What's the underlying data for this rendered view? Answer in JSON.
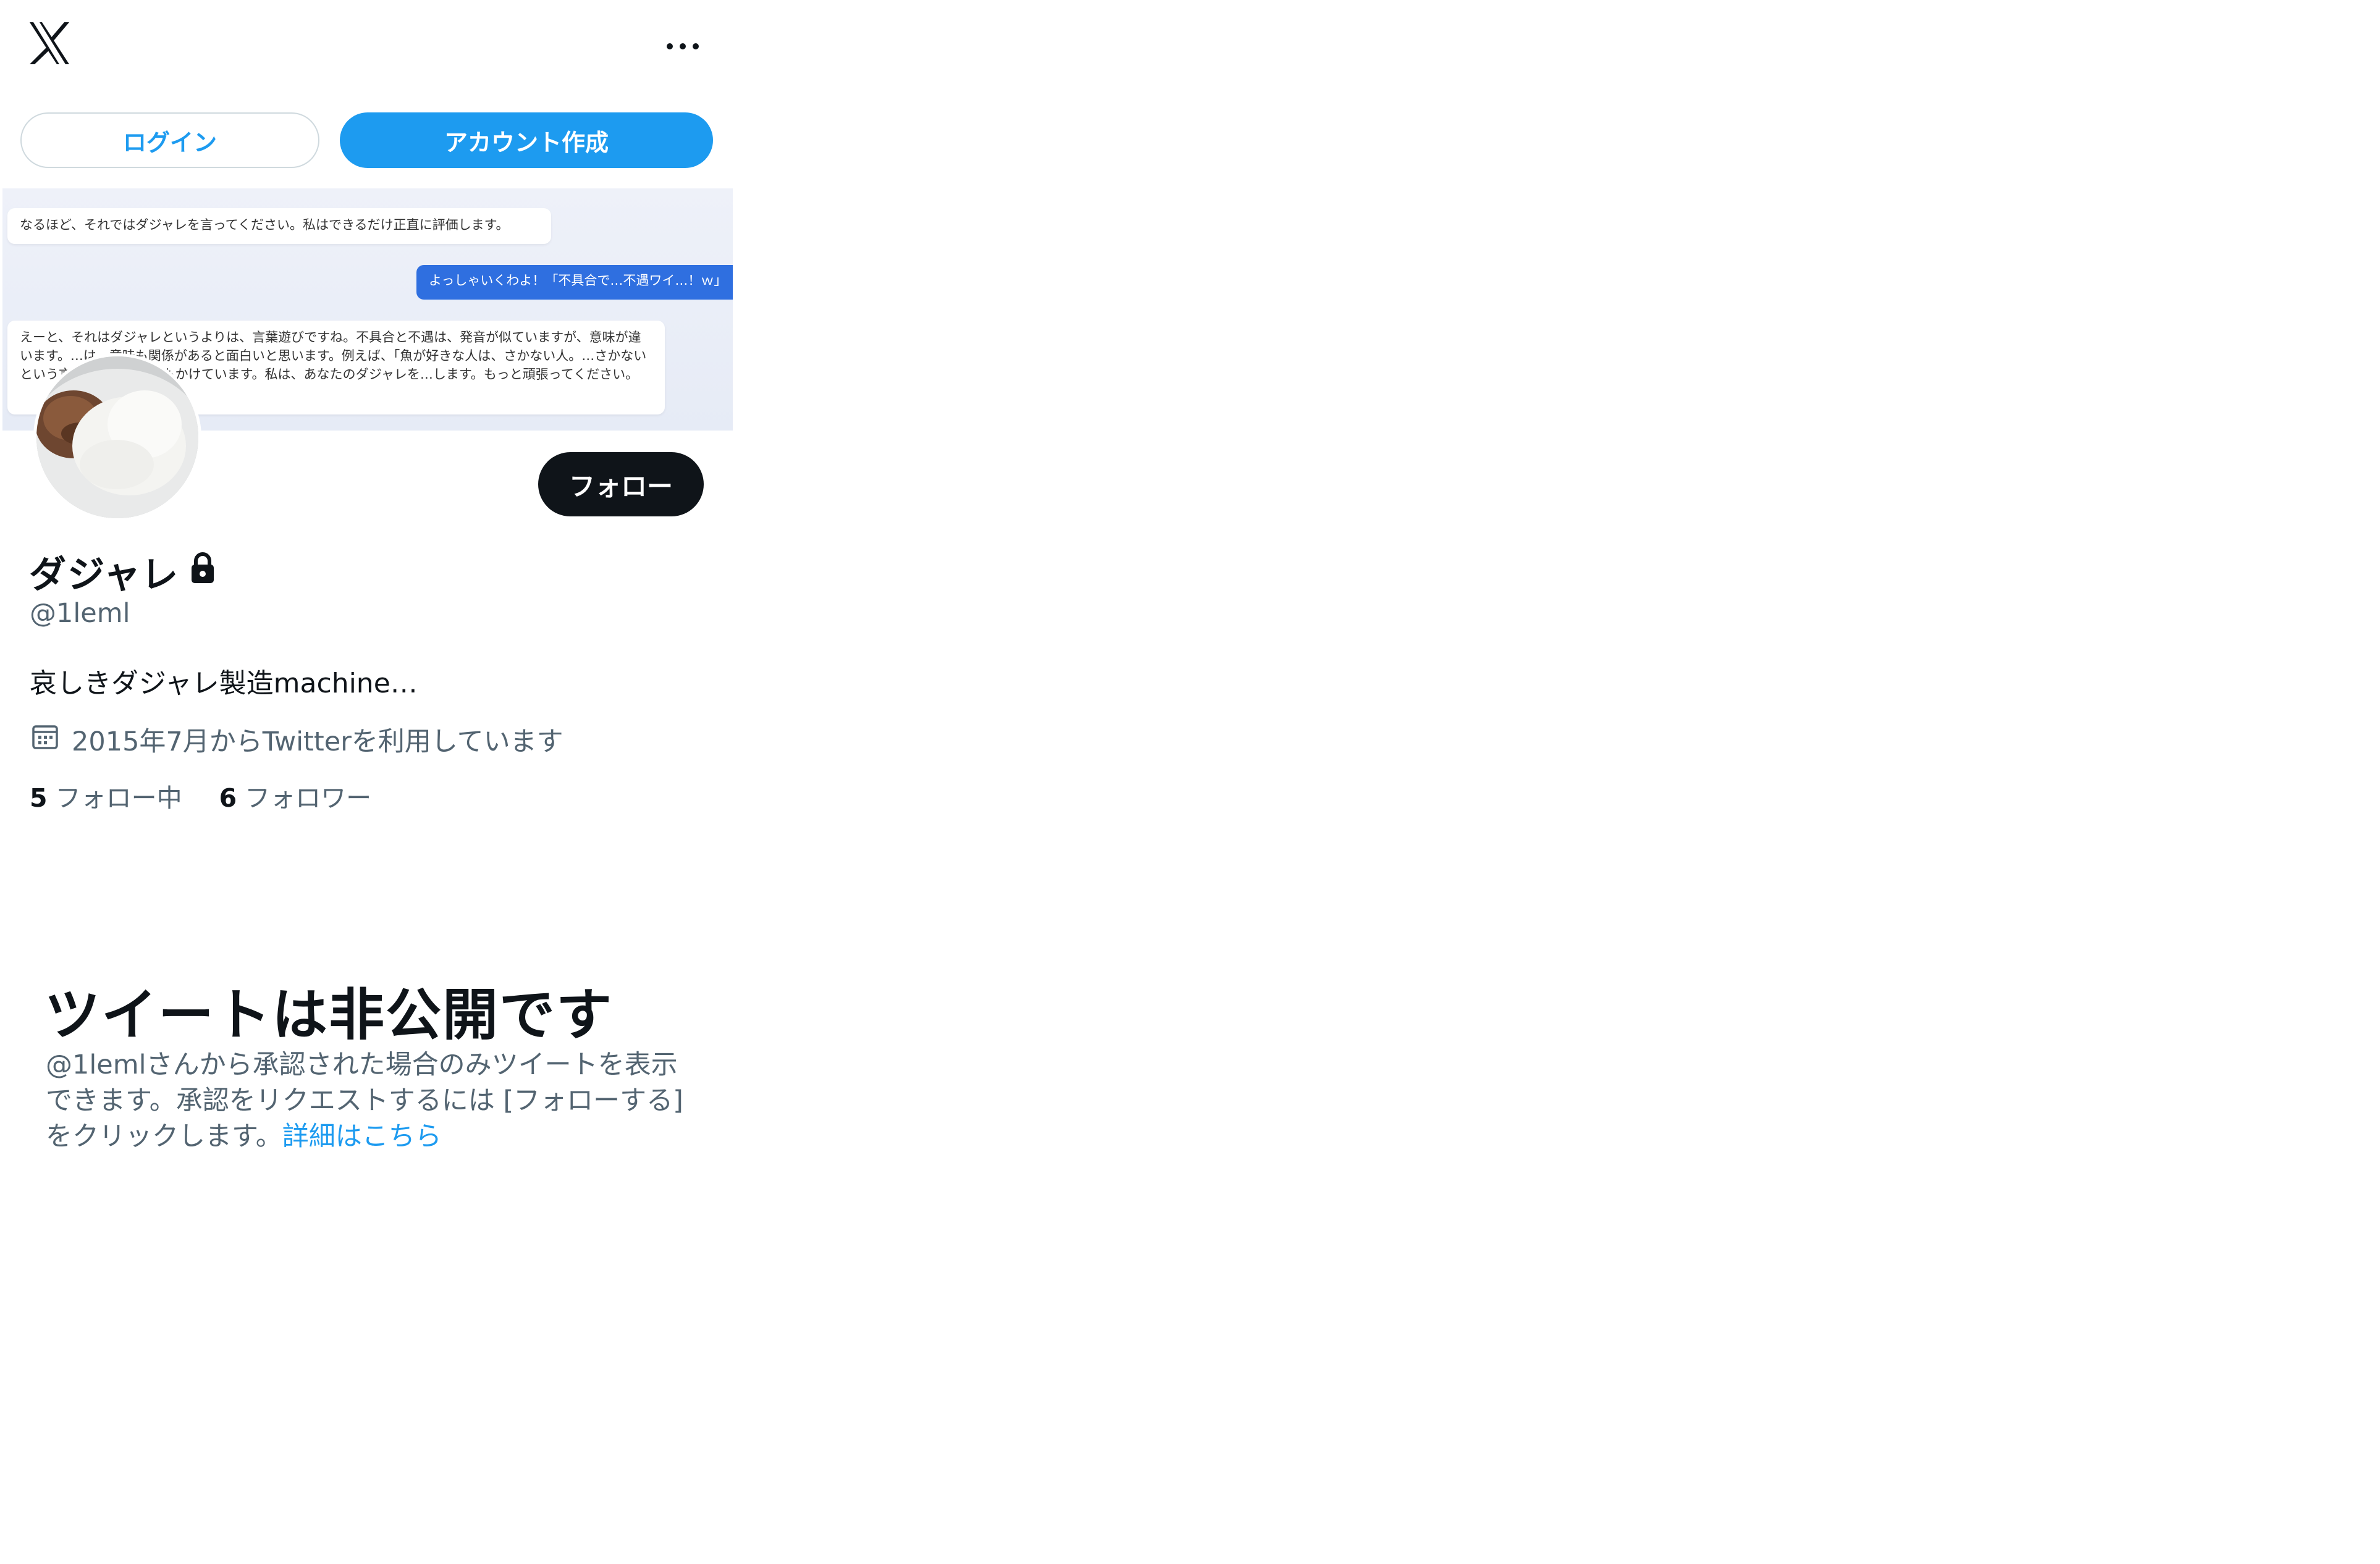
{
  "topbar": {
    "logo": "x-logo",
    "more": "more-icon"
  },
  "auth": {
    "login_label": "ログイン",
    "signup_label": "アカウント作成"
  },
  "banner": {
    "bubble1": "なるほど、それではダジャレを言ってください。私はできるだけ正直に評価します。",
    "bubble2": "よっしゃいくわよ！「不具合で…不遇ワイ…！ｗ」",
    "bubble3": "えーと、それはダジャレというよりは、言葉遊びですね。不具合と不遇は、発音が似ていますが、意味が違います。…は、意味も関係があると面白いと思います。例えば、「魚が好きな人は、さかない人。…さかないという言葉が、意味も音もかけています。私は、あなたのダジャレを…します。もっと頑張ってください。"
  },
  "profile": {
    "follow_label": "フォロー",
    "name": "ダジャレ",
    "handle": "@1leml",
    "bio": "哀しきダジャレ製造machine…",
    "joined": "2015年7月からTwitterを利用しています",
    "following_count": "5",
    "following_label": "フォロー中",
    "followers_count": "6",
    "followers_label": "フォロワー"
  },
  "private": {
    "title": "ツイートは非公開です",
    "body": "@1lemlさんから承認された場合のみツイートを表示できます。承認をリクエストするには [フォローする] をクリックします。",
    "link": "詳細はこちら"
  },
  "colors": {
    "accent": "#1d9bf0",
    "text": "#0f1419",
    "muted": "#536471",
    "follow_bg": "#0f1419"
  }
}
